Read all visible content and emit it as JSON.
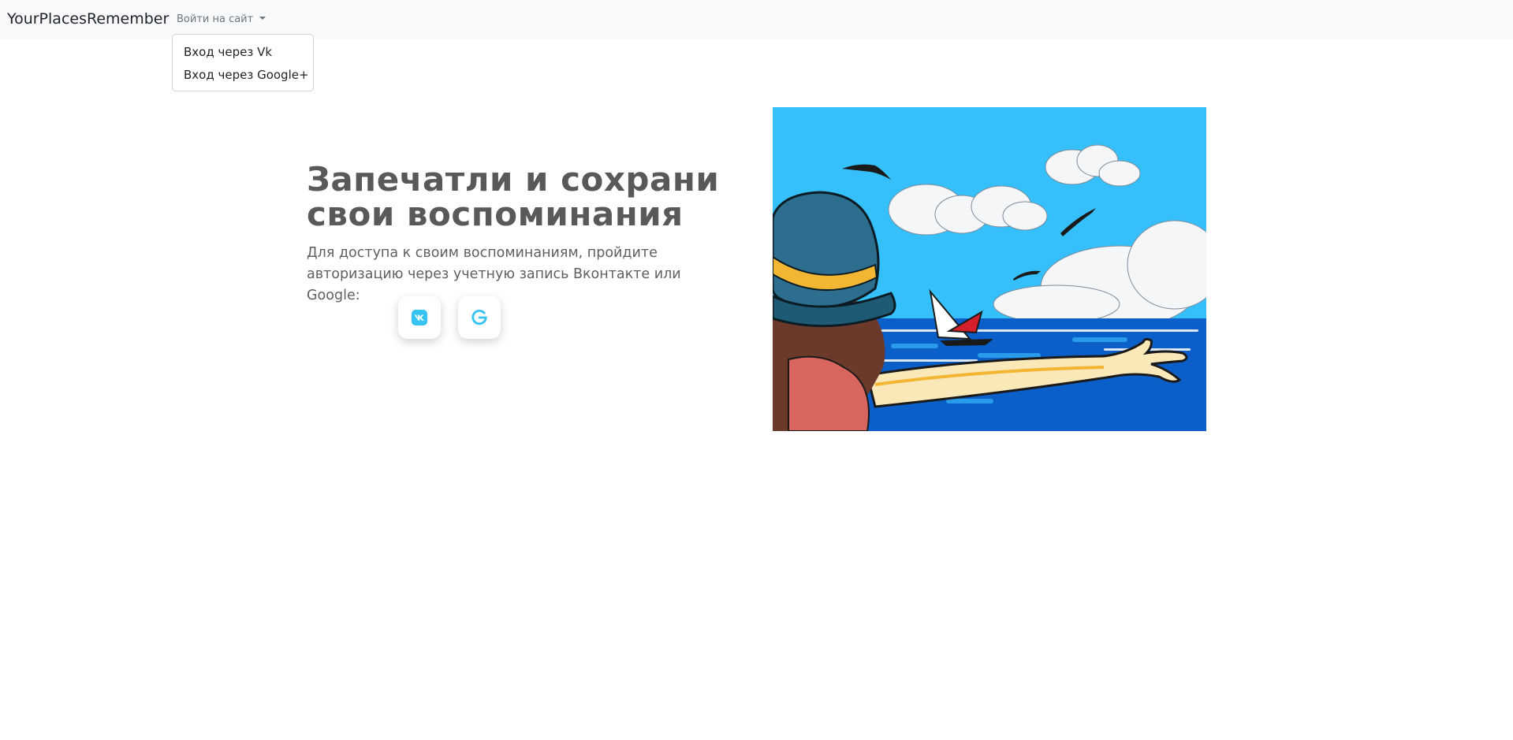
{
  "navbar": {
    "brand": "YourPlacesRemember",
    "login_toggle": "Войти на сайт",
    "dropdown": [
      {
        "label": "Вход через Vk"
      },
      {
        "label": "Вход через Google+"
      }
    ]
  },
  "hero": {
    "title": "Запечатли и сохрани свои воспоминания",
    "description": "Для доступа к своим воспоминаниям, пройдите авторизацию через учетную запись Вконтакте или Google:",
    "buttons": {
      "vk_icon": "vk-icon",
      "google_icon": "google-icon"
    },
    "image_icon": "seaside-illustration"
  },
  "colors": {
    "navbar_bg": "#f8f9fa",
    "heading": "#595959",
    "icon_accent": "#35c3f3",
    "sky": "#35c0fb",
    "sea": "#0b5fc9"
  }
}
